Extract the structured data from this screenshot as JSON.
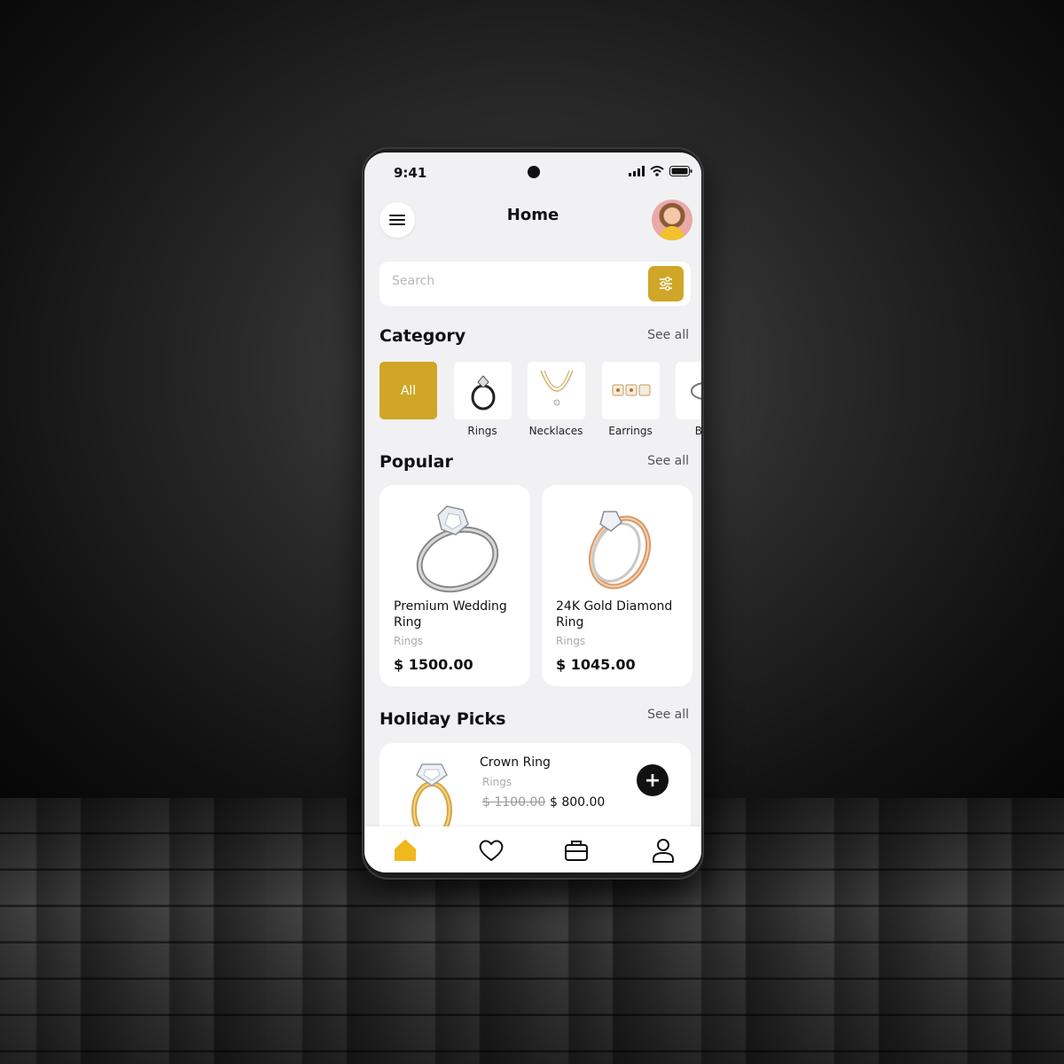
{
  "status_bar": {
    "time": "9:41"
  },
  "header": {
    "title": "Home"
  },
  "search": {
    "placeholder": "Search"
  },
  "category": {
    "title": "Category",
    "see_all": "See all",
    "items": [
      {
        "label": "All",
        "icon": "all-icon"
      },
      {
        "label": "Rings",
        "icon": "ring-icon"
      },
      {
        "label": "Necklaces",
        "icon": "necklace-icon"
      },
      {
        "label": "Earrings",
        "icon": "earrings-icon"
      },
      {
        "label": "Bra",
        "icon": "bracelet-icon"
      }
    ]
  },
  "popular": {
    "title": "Popular",
    "see_all": "See all",
    "items": [
      {
        "name": "Premium Wedding Ring",
        "category": "Rings",
        "price": "$ 1500.00"
      },
      {
        "name": "24K Gold Diamond Ring",
        "category": "Rings",
        "price": "$ 1045.00"
      }
    ]
  },
  "holiday": {
    "title": "Holiday Picks",
    "see_all": "See all",
    "items": [
      {
        "name": "Crown Ring",
        "category": "Rings",
        "old_price": "$ 1100.00",
        "price": "$ 800.00",
        "add": "+"
      }
    ]
  },
  "colors": {
    "accent": "#cfa628",
    "background": "#f1f1f3",
    "dark": "#111111"
  },
  "tabbar": {
    "tabs": [
      "home-icon",
      "heart-icon",
      "bag-icon",
      "user-icon"
    ],
    "active": "home-icon"
  }
}
